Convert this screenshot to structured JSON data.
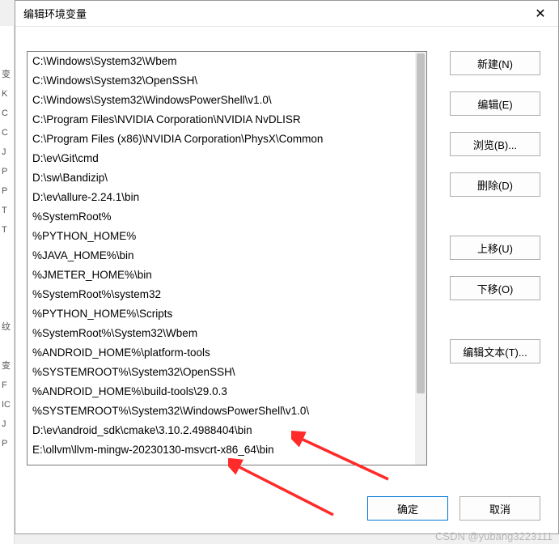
{
  "dialog": {
    "title": "编辑环境变量",
    "close_icon": "✕"
  },
  "paths": [
    "C:\\Windows\\System32\\Wbem",
    "C:\\Windows\\System32\\OpenSSH\\",
    "C:\\Windows\\System32\\WindowsPowerShell\\v1.0\\",
    "C:\\Program Files\\NVIDIA Corporation\\NVIDIA NvDLISR",
    "C:\\Program Files (x86)\\NVIDIA Corporation\\PhysX\\Common",
    "D:\\ev\\Git\\cmd",
    "D:\\sw\\Bandizip\\",
    "D:\\ev\\allure-2.24.1\\bin",
    "%SystemRoot%",
    "%PYTHON_HOME%",
    "%JAVA_HOME%\\bin",
    "%JMETER_HOME%\\bin",
    "%SystemRoot%\\system32",
    "%PYTHON_HOME%\\Scripts",
    "%SystemRoot%\\System32\\Wbem",
    "%ANDROID_HOME%\\platform-tools",
    "%SYSTEMROOT%\\System32\\OpenSSH\\",
    "%ANDROID_HOME%\\build-tools\\29.0.3",
    "%SYSTEMROOT%\\System32\\WindowsPowerShell\\v1.0\\",
    "D:\\ev\\android_sdk\\cmake\\3.10.2.4988404\\bin",
    "E:\\ollvm\\llvm-mingw-20230130-msvcrt-x86_64\\bin"
  ],
  "buttons": {
    "new": "新建(N)",
    "edit": "编辑(E)",
    "browse": "浏览(B)...",
    "delete": "删除(D)",
    "move_up": "上移(U)",
    "move_down": "下移(O)",
    "edit_text": "编辑文本(T)...",
    "ok": "确定",
    "cancel": "取消"
  },
  "watermark": "CSDN @yubang3223111",
  "bg_letters": [
    "",
    "",
    "变",
    "K",
    "C",
    "C",
    "J",
    "P",
    "P",
    "T",
    "T",
    "",
    "",
    "",
    "",
    "纹",
    "",
    "变",
    "F",
    "IC",
    "J",
    "P"
  ],
  "annotations": {
    "arrow1_target": "D:\\ev\\android_sdk\\cmake\\3.10.2.4988404\\bin",
    "arrow2_target": "E:\\ollvm\\llvm-mingw-20230130-msvcrt-x86_64\\bin",
    "arrow_color": "#ff2a2a"
  }
}
